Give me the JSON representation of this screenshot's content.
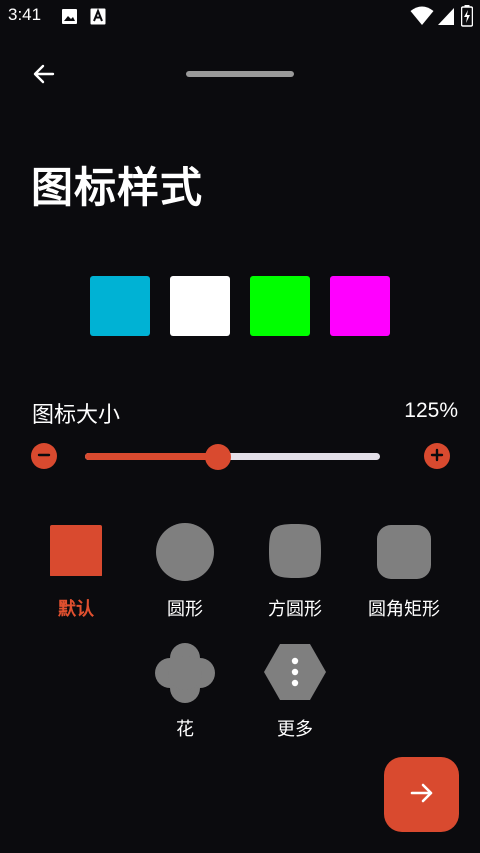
{
  "status_bar": {
    "time": "3:41",
    "icons": [
      "image-icon",
      "font-a-icon",
      "wifi-icon",
      "battery-charging-icon"
    ]
  },
  "header": {
    "back_icon": "arrow-left-icon"
  },
  "page": {
    "title": "图标样式"
  },
  "colors": {
    "accent": "#d94a2f",
    "swatches": [
      {
        "name": "cyan",
        "hex": "#00b2d4"
      },
      {
        "name": "white",
        "hex": "#ffffff"
      },
      {
        "name": "green",
        "hex": "#00ff00"
      },
      {
        "name": "magenta",
        "hex": "#ff00ff"
      }
    ]
  },
  "icon_size": {
    "label": "图标大小",
    "value_text": "125%",
    "slider_fraction": 0.45,
    "minus_icon": "minus-icon",
    "plus_icon": "plus-icon"
  },
  "shapes": [
    {
      "id": "default",
      "label": "默认",
      "selected": true
    },
    {
      "id": "circle",
      "label": "圆形",
      "selected": false
    },
    {
      "id": "squircle",
      "label": "方圆形",
      "selected": false
    },
    {
      "id": "rounded-rect",
      "label": "圆角矩形",
      "selected": false
    },
    {
      "id": "flower",
      "label": "花",
      "selected": false
    },
    {
      "id": "more",
      "label": "更多",
      "selected": false
    }
  ],
  "fab": {
    "icon": "arrow-right-icon"
  }
}
